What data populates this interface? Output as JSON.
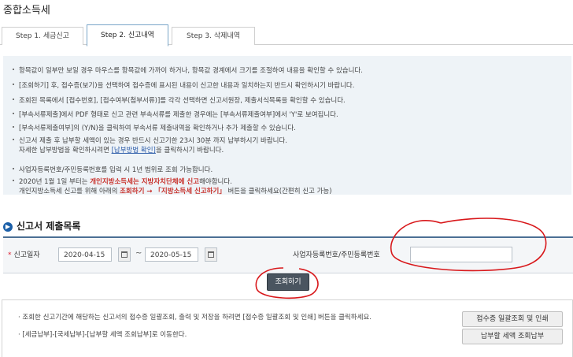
{
  "page": {
    "title": "종합소득세"
  },
  "tabs": [
    {
      "label": "Step 1. 세금신고"
    },
    {
      "label": "Step 2. 신고내역"
    },
    {
      "label": "Step 3. 삭제내역"
    }
  ],
  "notice": {
    "items": [
      "항목값이 일부만 보일 경우 마우스를 항목값에 가까이 하거나, 항목값 경계에서 크기를 조절하여 내용을 확인할 수 있습니다.",
      "[조회하기] 후, 접수증(보기)을 선택하여 접수증에 표시된 내용이 신고한 내용과 일치하는지 반드시 확인하시기 바랍니다.",
      "조회된 목록에서 [접수번호], [접수여부(첨부서류)]를 각각 선택하면 신고서원장, 제출서식목록을 확인할 수 있습니다.",
      "[부속서류제출]에서 PDF 형태로 신고 관련 부속서류를 제출한 경우에는 [부속서류제출여부]에서 'Y'로 보여집니다.",
      "[부속서류제출여부]의 (Y/N)을 클릭하여 부속서류 제출내역을 확인하거나 추가 제출할 수 있습니다.",
      "사업자등록번호/주민등록번호를 입력 시 1년 범위로 조회 가능합니다."
    ],
    "payment": {
      "line1": "신고서 제출 후 납부할 세액이 있는 경우 반드시 신고기한 23시 30분 까지 납부하시기 바랍니다.",
      "line2_pre": "자세한 납부방법을 확인하시려면 ",
      "line2_link": "[납부방법 확인]",
      "line2_post": "을 클릭하시기 바랍니다."
    },
    "local": {
      "pre": "2020년 1월 1일 부터는 ",
      "red": "개인지방소득세는 지방자치단체에 신고",
      "post": "해야합니다.",
      "line2_pre": "개인지방소득세 신고를 위해 아래의 ",
      "line2_red": "조회하기 → 「지방소득세 신고하기」",
      "line2_post": " 버튼을 클릭하세요(간편히 신고 가능)"
    }
  },
  "section": {
    "title": "신고서 제출목록"
  },
  "search": {
    "date_label": "신고일자",
    "from": "2020-04-15",
    "to": "2020-05-15",
    "tilde": "~",
    "biz_label": "사업자등록번호/주민등록번호",
    "biz_value": "",
    "button": "조회하기"
  },
  "bottom": {
    "line1": "· 조회한 신고기간에 해당하는 신고서의 접수증 일괄조회, 출력 및 저장을 하려면 [접수증 일괄조회 및 인쇄] 버튼을 클릭하세요.",
    "line2": "· [세금납부]-[국세납부]-[납부할 세액 조회납부]로 이동한다.",
    "btn1": "접수증 일괄조회 및 인쇄",
    "btn2": "납부할 세액 조회납부"
  },
  "colors": {
    "annotation": "#d8171a",
    "accent": "#1b5fa8",
    "highlight": "#c8302a"
  }
}
